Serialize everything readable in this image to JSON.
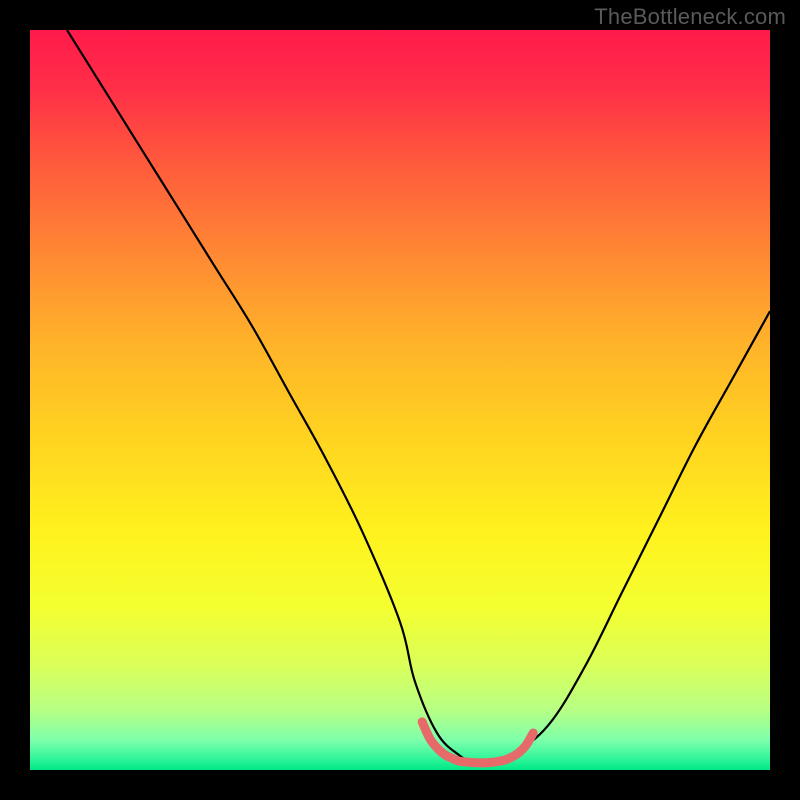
{
  "watermark": "TheBottleneck.com",
  "gradient": {
    "stops": [
      {
        "offset": 0.0,
        "color": "#ff1a4b"
      },
      {
        "offset": 0.08,
        "color": "#ff2f47"
      },
      {
        "offset": 0.18,
        "color": "#ff5a3c"
      },
      {
        "offset": 0.3,
        "color": "#ff8734"
      },
      {
        "offset": 0.42,
        "color": "#ffb22a"
      },
      {
        "offset": 0.55,
        "color": "#ffd320"
      },
      {
        "offset": 0.68,
        "color": "#fff21e"
      },
      {
        "offset": 0.78,
        "color": "#f4ff30"
      },
      {
        "offset": 0.86,
        "color": "#d9ff5a"
      },
      {
        "offset": 0.92,
        "color": "#b6ff85"
      },
      {
        "offset": 0.96,
        "color": "#7dffab"
      },
      {
        "offset": 0.985,
        "color": "#30f59a"
      },
      {
        "offset": 1.0,
        "color": "#00e884"
      }
    ]
  },
  "chart_data": {
    "type": "line",
    "title": "",
    "xlabel": "",
    "ylabel": "",
    "xlim": [
      0,
      100
    ],
    "ylim": [
      0,
      100
    ],
    "grid": false,
    "legend": false,
    "series": [
      {
        "name": "bottleneck-curve",
        "color": "#000000",
        "width": 2.2,
        "x": [
          5,
          10,
          15,
          20,
          25,
          30,
          35,
          40,
          45,
          50,
          52,
          55,
          58,
          60,
          62,
          65,
          70,
          75,
          80,
          85,
          90,
          95,
          100
        ],
        "y": [
          100,
          92,
          84,
          76,
          68,
          60,
          51,
          42,
          32,
          20,
          12,
          5,
          2,
          1,
          1,
          2,
          6,
          14,
          24,
          34,
          44,
          53,
          62
        ]
      },
      {
        "name": "safe-zone-marker",
        "color": "#e66a6a",
        "width": 9,
        "linecap": "round",
        "x": [
          53,
          54,
          55,
          56,
          57,
          58,
          60,
          62,
          64,
          65,
          66,
          67,
          68
        ],
        "y": [
          6.5,
          4.3,
          3.0,
          2.1,
          1.6,
          1.2,
          1.0,
          1.0,
          1.3,
          1.7,
          2.3,
          3.3,
          5.0
        ]
      }
    ]
  }
}
